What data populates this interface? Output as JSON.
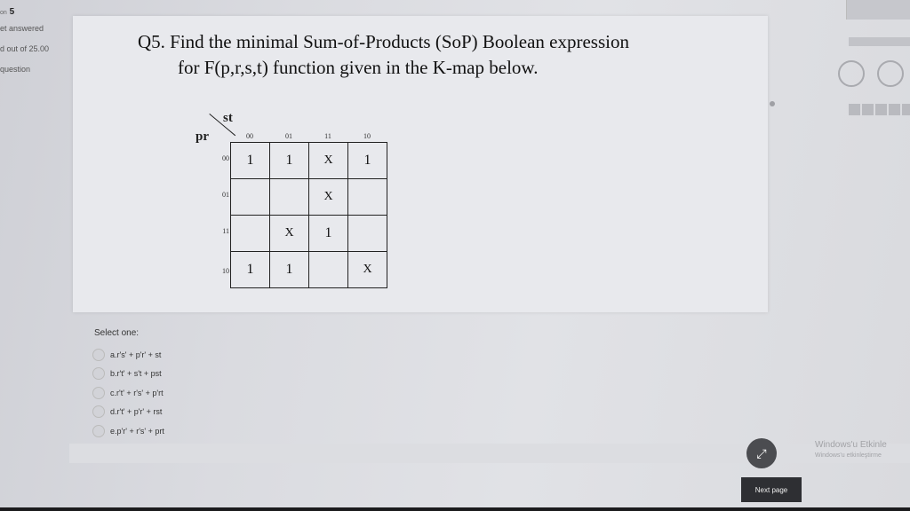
{
  "sidebar": {
    "question_prefix": "on",
    "question_number": "5",
    "status": "et answered",
    "marks": "d out of 25.00",
    "flag": "question"
  },
  "question": {
    "line1": "Q5. Find the minimal Sum-of-Products (SoP) Boolean expression",
    "line2": "for F(p,r,s,t) function given in the K-map below."
  },
  "kmap": {
    "col_var": "st",
    "row_var": "pr",
    "col_headers": [
      "00",
      "01",
      "11",
      "10"
    ],
    "row_headers": [
      "00",
      "01",
      "11",
      "10"
    ],
    "cells": [
      [
        "1",
        "1",
        "X",
        "1"
      ],
      [
        "",
        "",
        "X",
        ""
      ],
      [
        "",
        "X",
        "1",
        ""
      ],
      [
        "1",
        "1",
        "",
        "X"
      ]
    ]
  },
  "select_one_label": "Select one:",
  "options": [
    "a.r's' + p'r' + st",
    "b.r't' + s't + pst",
    "c.r't' + r's' + p'rt",
    "d.r't' + p'r' + rst",
    "e.p'r' + r's' + prt"
  ],
  "fab_icon": "expand-icon",
  "next_page_label": "Next page",
  "windows_notice": {
    "line1": "Windows'u Etkinle",
    "line2": "Windows'u etkinleştirme"
  }
}
